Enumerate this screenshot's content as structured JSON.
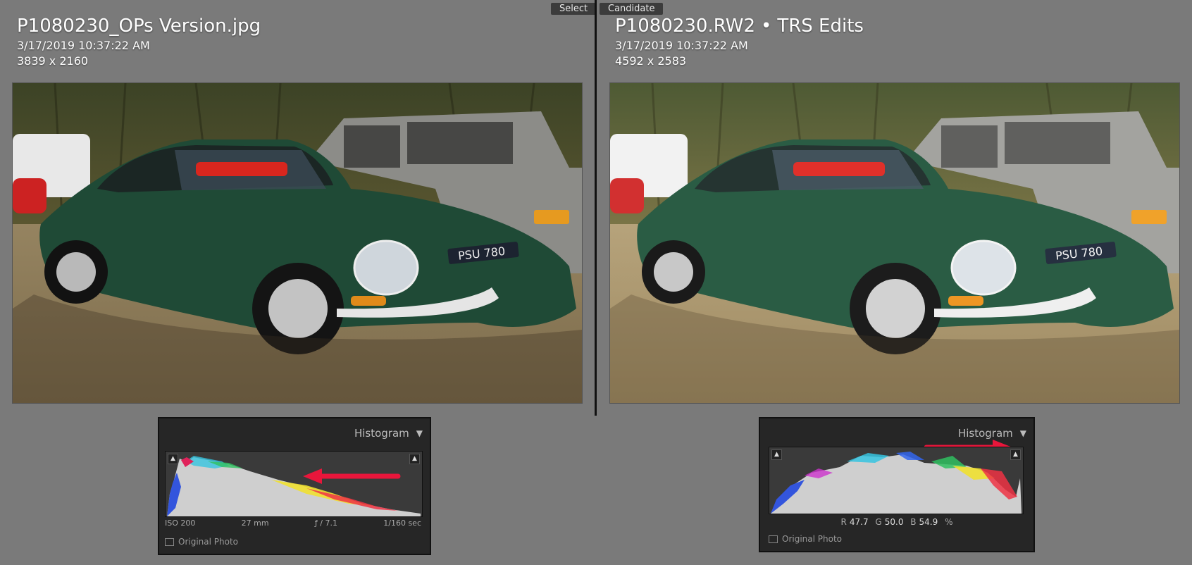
{
  "header": {
    "select_label": "Select",
    "candidate_label": "Candidate"
  },
  "left": {
    "filename": "P1080230_OPs Version.jpg",
    "date": "3/17/2019 10:37:22 AM",
    "dimensions": "3839 x 2160"
  },
  "right": {
    "filename": "P1080230.RW2",
    "separator": "•",
    "filename_suffix": "TRS Edits",
    "date": "3/17/2019 10:37:22 AM",
    "dimensions": "4592 x 2583"
  },
  "histogram_left": {
    "title": "Histogram",
    "iso": "ISO 200",
    "focal": "27 mm",
    "aperture": "ƒ / 7.1",
    "shutter": "1/160 sec",
    "original_photo": "Original Photo"
  },
  "histogram_right": {
    "title": "Histogram",
    "r_label": "R",
    "r_value": "47.7",
    "g_label": "G",
    "g_value": "50.0",
    "b_label": "B",
    "b_value": "54.9",
    "pct": "%",
    "original_photo": "Original Photo"
  },
  "colors": {
    "annotation_arrow": "#e8163b",
    "car_green": "#1f4a36",
    "panel_bg": "#262626"
  },
  "icons": [
    "triangle-clip-icon",
    "chevron-down-icon",
    "checkbox-icon",
    "arrow-annotation-icon"
  ]
}
